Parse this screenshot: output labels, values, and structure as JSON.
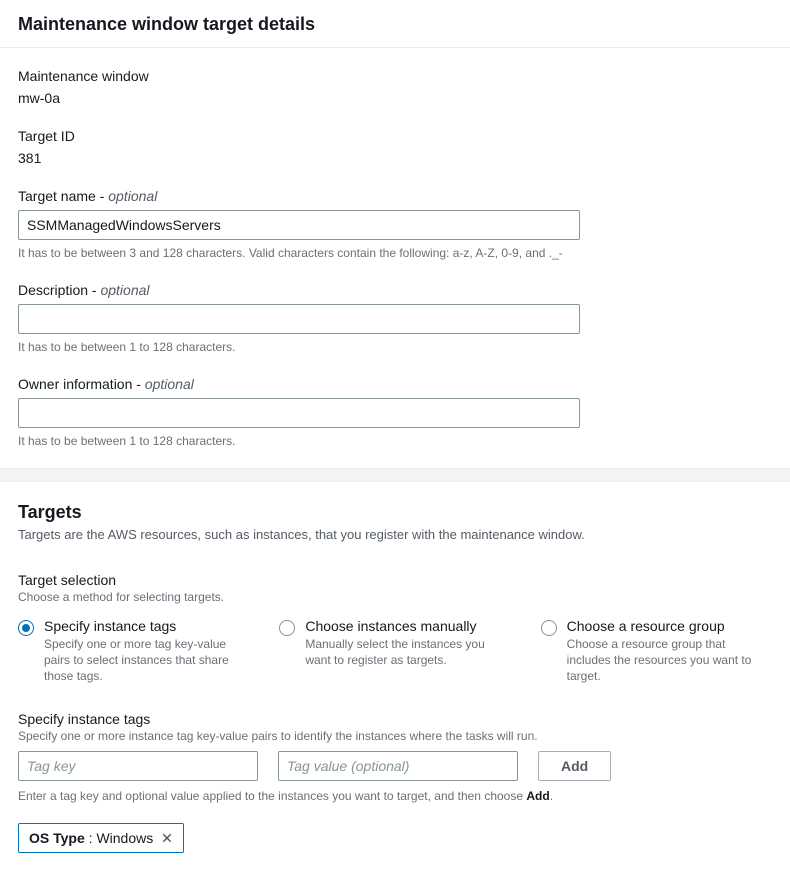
{
  "header": {
    "title": "Maintenance window target details"
  },
  "details": {
    "mw_label": "Maintenance window",
    "mw_value": "mw-0a",
    "target_id_label": "Target ID",
    "target_id_value": "381",
    "target_name_label": "Target name - ",
    "target_name_optional": "optional",
    "target_name_value": "SSMManagedWindowsServers",
    "target_name_hint": "It has to be between 3 and 128 characters. Valid characters contain the following: a-z, A-Z, 0-9, and ._-",
    "description_label": "Description - ",
    "description_optional": "optional",
    "description_value": "",
    "description_hint": "It has to be between 1 to 128 characters.",
    "owner_label": "Owner information - ",
    "owner_optional": "optional",
    "owner_value": "",
    "owner_hint": "It has to be between 1 to 128 characters."
  },
  "targets": {
    "heading": "Targets",
    "sub": "Targets are the AWS resources, such as instances, that you register with the maintenance window.",
    "selection_label": "Target selection",
    "selection_hint": "Choose a method for selecting targets.",
    "options": [
      {
        "title": "Specify instance tags",
        "desc": "Specify one or more tag key-value pairs to select instances that share those tags."
      },
      {
        "title": "Choose instances manually",
        "desc": "Manually select the instances you want to register as targets."
      },
      {
        "title": "Choose a resource group",
        "desc": "Choose a resource group that includes the resources you want to target."
      }
    ],
    "selected_index": 0,
    "tags_label": "Specify instance tags",
    "tags_hint": "Specify one or more instance tag key-value pairs to identify the instances where the tasks will run.",
    "tag_key_placeholder": "Tag key",
    "tag_value_placeholder": "Tag value (optional)",
    "add_label": "Add",
    "entry_hint_pre": "Enter a tag key and optional value applied to the instances you want to target, and then choose ",
    "entry_hint_bold": "Add",
    "entry_hint_post": ".",
    "token": {
      "key": "OS Type",
      "sep": " : ",
      "value": "Windows"
    }
  }
}
